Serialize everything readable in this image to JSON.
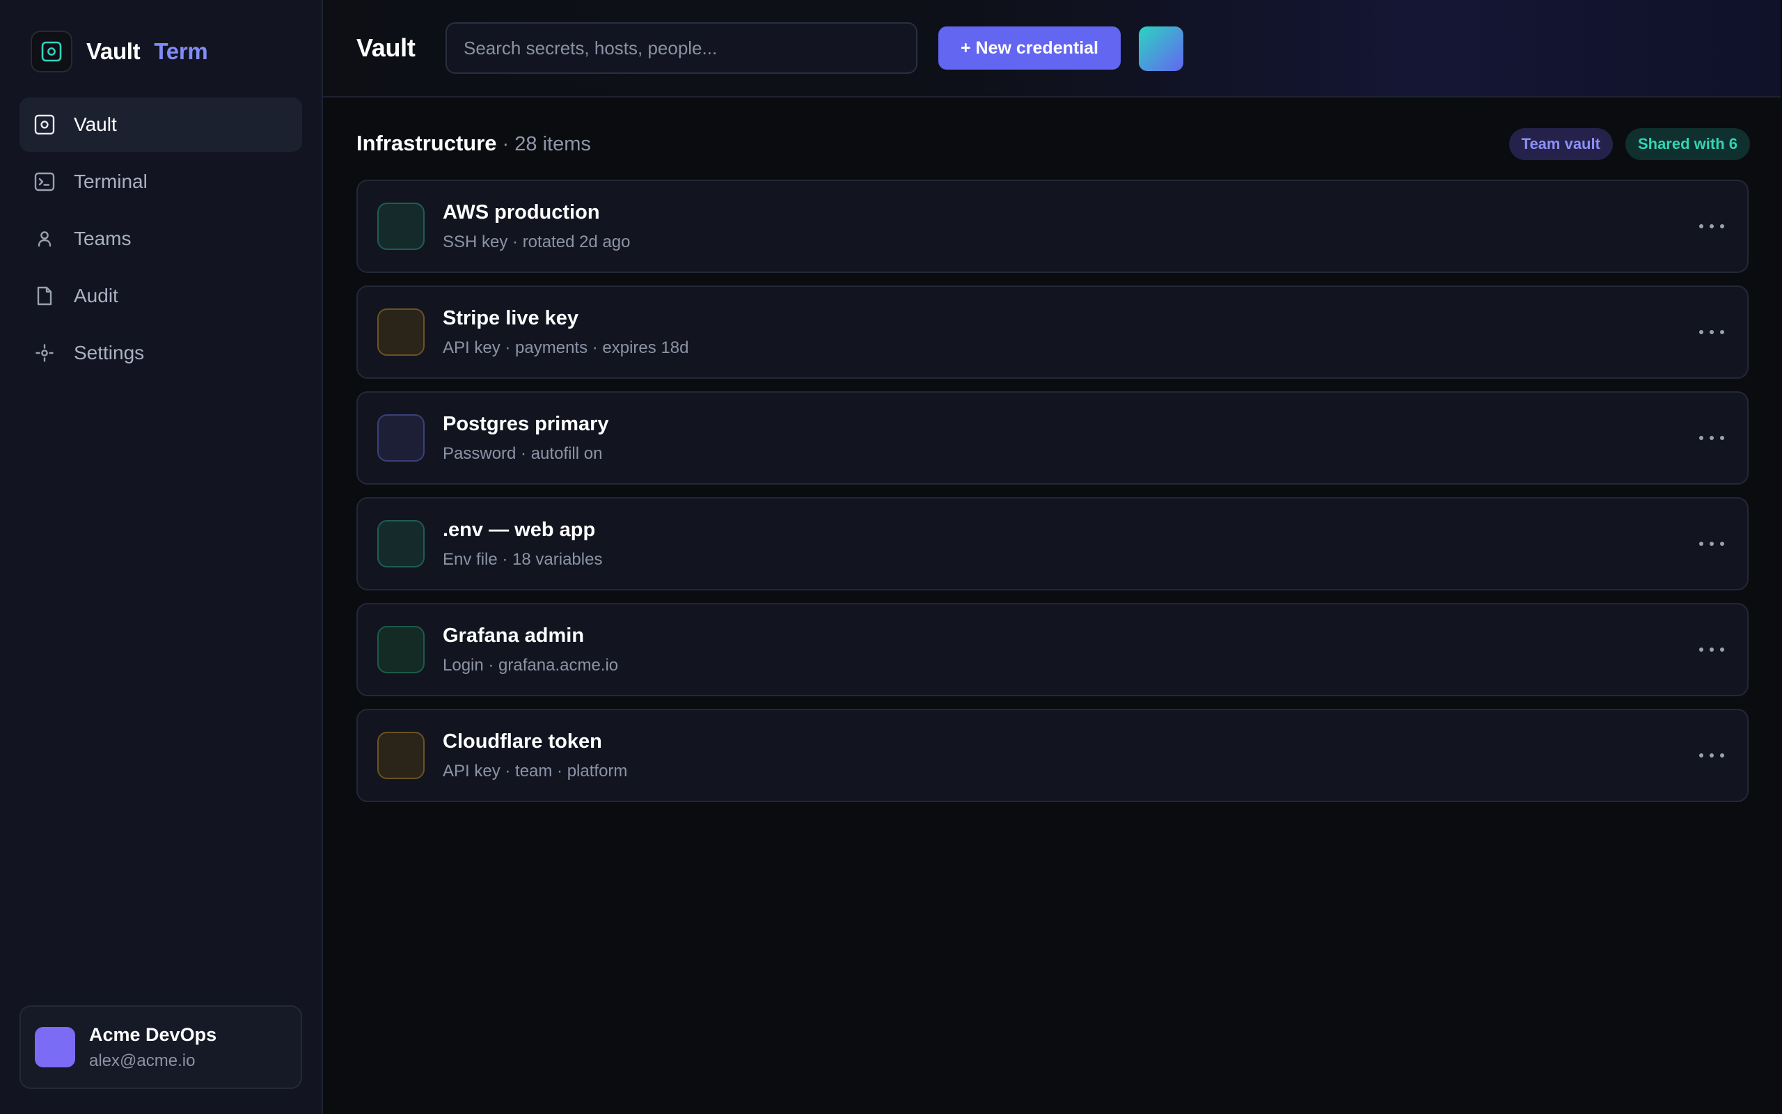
{
  "brand": {
    "name": "Vault",
    "accent": "Term"
  },
  "sidebar": {
    "items": [
      {
        "label": "Vault",
        "icon": "vault-icon",
        "active": true
      },
      {
        "label": "Terminal",
        "icon": "terminal-icon",
        "active": false
      },
      {
        "label": "Teams",
        "icon": "user-icon",
        "active": false
      },
      {
        "label": "Audit",
        "icon": "document-icon",
        "active": false
      },
      {
        "label": "Settings",
        "icon": "gear-icon",
        "active": false
      }
    ]
  },
  "account": {
    "name": "Acme DevOps",
    "email": "alex@acme.io"
  },
  "header": {
    "title": "Vault",
    "search_placeholder": "Search secrets, hosts, people...",
    "new_button": "+ New credential"
  },
  "section": {
    "title": "Infrastructure",
    "count": "· 28 items",
    "badges": [
      "Team vault",
      "Shared with 6"
    ]
  },
  "items": [
    {
      "title": "AWS production",
      "subtitle": "SSH key · rotated 2d ago",
      "color": "teal"
    },
    {
      "title": "Stripe live key",
      "subtitle": "API key · payments · expires 18d",
      "color": "amber"
    },
    {
      "title": "Postgres primary",
      "subtitle": "Password · autofill on",
      "color": "indigo"
    },
    {
      "title": ".env — web app",
      "subtitle": "Env file · 18 variables",
      "color": "teal"
    },
    {
      "title": "Grafana admin",
      "subtitle": "Login · grafana.acme.io",
      "color": "green"
    },
    {
      "title": "Cloudflare token",
      "subtitle": "API key · team · platform",
      "color": "amber"
    }
  ],
  "colors": {
    "accent": "#6366f1",
    "accent_text": "#818cf8",
    "teal": "#34d3b4",
    "sidebar_bg": "#121521",
    "page_bg": "#0b0c10"
  }
}
